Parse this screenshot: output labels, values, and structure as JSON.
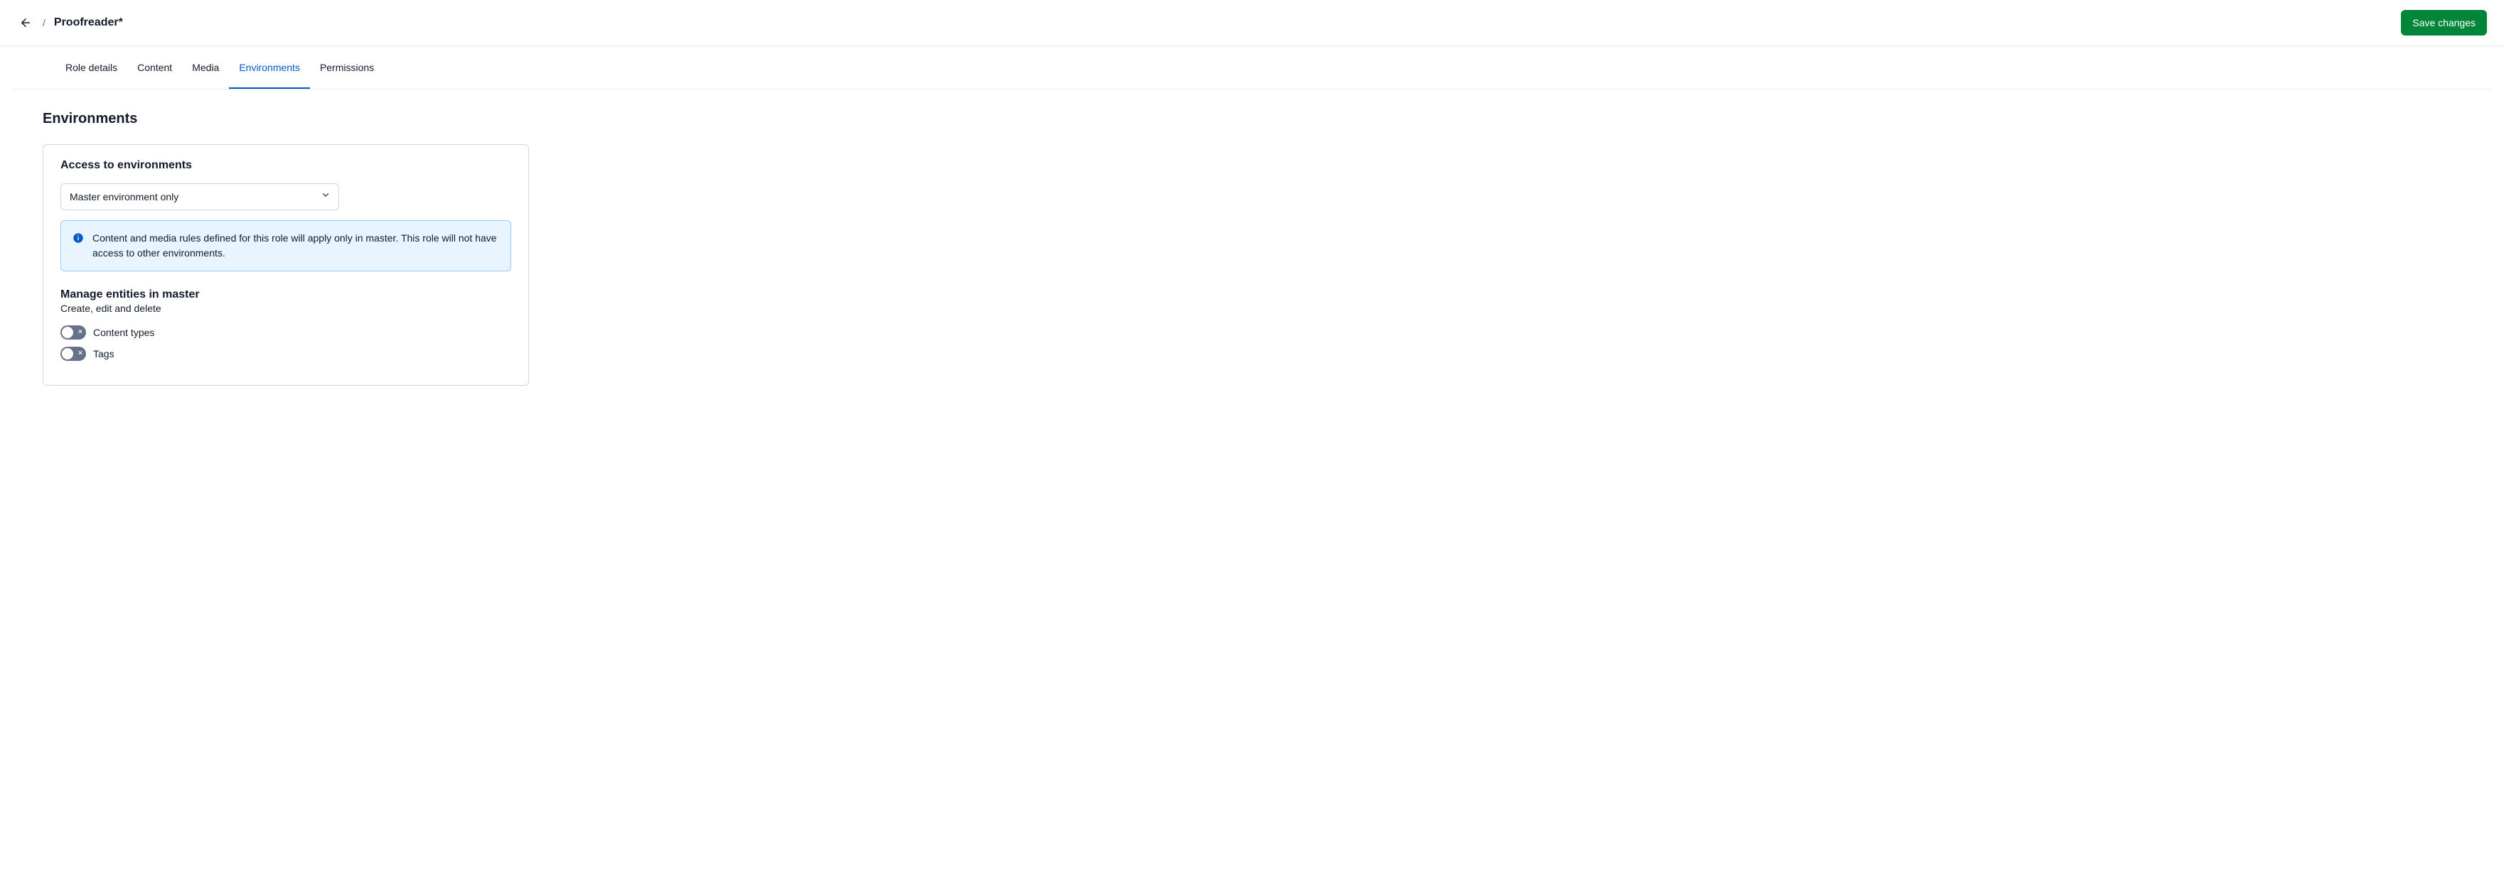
{
  "header": {
    "title": "Proofreader*",
    "save_label": "Save changes"
  },
  "tabs": [
    {
      "label": "Role details",
      "active": false
    },
    {
      "label": "Content",
      "active": false
    },
    {
      "label": "Media",
      "active": false
    },
    {
      "label": "Environments",
      "active": true
    },
    {
      "label": "Permissions",
      "active": false
    }
  ],
  "section": {
    "heading": "Environments",
    "access_heading": "Access to environments",
    "select_value": "Master environment only",
    "info_text": "Content and media rules defined for this role will apply only in master. This role will not have access to other environments.",
    "manage_heading": "Manage entities in master",
    "manage_sub": "Create, edit and delete",
    "toggles": [
      {
        "label": "Content types",
        "on": false
      },
      {
        "label": "Tags",
        "on": false
      }
    ]
  }
}
